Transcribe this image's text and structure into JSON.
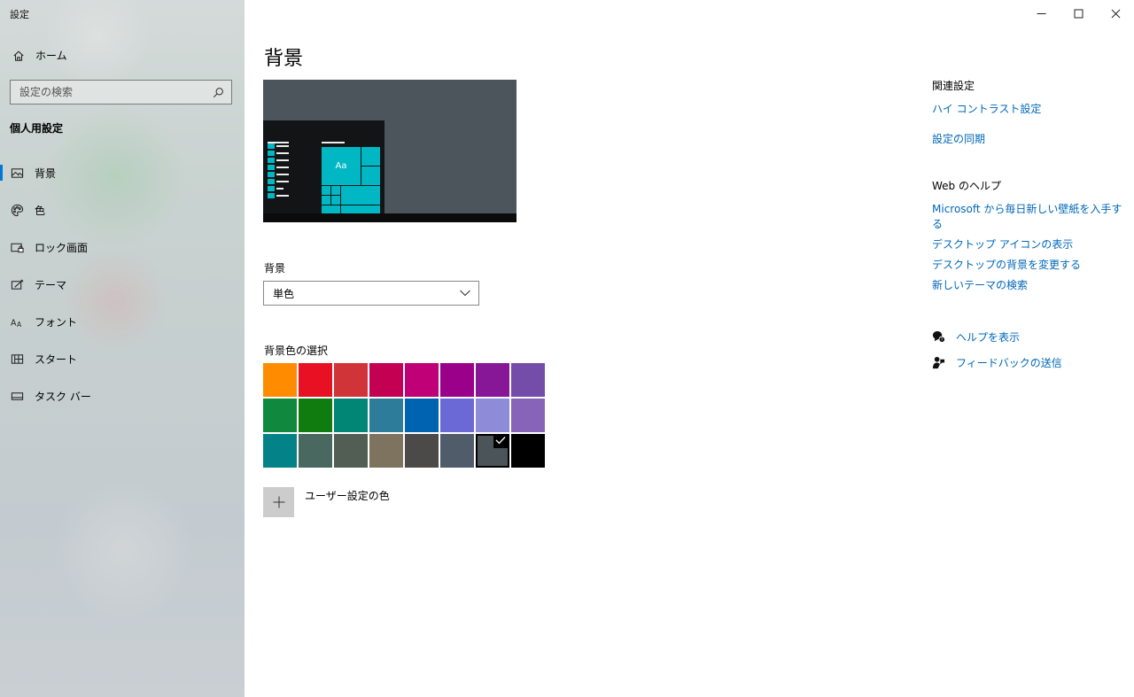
{
  "app": {
    "title": "設定"
  },
  "window_controls": {
    "minimize_icon": "minimize-icon",
    "maximize_icon": "maximize-icon",
    "close_icon": "close-icon"
  },
  "sidebar": {
    "home_label": "ホーム",
    "search_placeholder": "設定の検索",
    "section_title": "個人用設定",
    "items": [
      {
        "label": "背景",
        "icon": "picture-icon",
        "active": true
      },
      {
        "label": "色",
        "icon": "palette-icon",
        "active": false
      },
      {
        "label": "ロック画面",
        "icon": "lock-screen-icon",
        "active": false
      },
      {
        "label": "テーマ",
        "icon": "theme-icon",
        "active": false
      },
      {
        "label": "フォント",
        "icon": "font-icon",
        "active": false
      },
      {
        "label": "スタート",
        "icon": "start-icon",
        "active": false
      },
      {
        "label": "タスク バー",
        "icon": "taskbar-icon",
        "active": false
      }
    ]
  },
  "main": {
    "title": "背景",
    "preview": {
      "tile_text": "Aa"
    },
    "background_label": "背景",
    "background_value": "単色",
    "color_select_label": "背景色の選択",
    "colors": [
      "#ff8c00",
      "#e81123",
      "#d13438",
      "#c30052",
      "#bf0077",
      "#9a0089",
      "#881798",
      "#744da9",
      "#10893e",
      "#107c10",
      "#018574",
      "#2d7d9a",
      "#0063b1",
      "#6b69d6",
      "#8e8cd8",
      "#8764b8",
      "#038387",
      "#486860",
      "#525e54",
      "#7e735f",
      "#4c4a48",
      "#515c6b",
      "#4a5459",
      "#000000"
    ],
    "selected_color_index": 22,
    "custom_color_label": "ユーザー設定の色"
  },
  "related": {
    "title": "関連設定",
    "links": [
      "ハイ コントラスト設定",
      "設定の同期"
    ]
  },
  "web_help": {
    "title": "Web のヘルプ",
    "links": [
      "Microsoft から毎日新しい壁紙を入手する",
      "デスクトップ アイコンの表示",
      "デスクトップの背景を変更する",
      "新しいテーマの検索"
    ]
  },
  "support": {
    "help_label": "ヘルプを表示",
    "feedback_label": "フィードバックの送信"
  }
}
